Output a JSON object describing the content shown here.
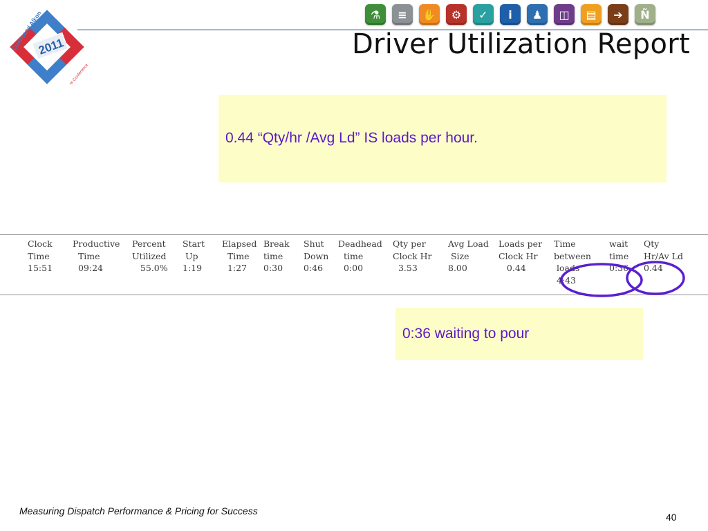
{
  "slide": {
    "title": "Driver Utilization Report",
    "note_loads": "0.44 “Qty/hr /Avg Ld” IS loads per hour.",
    "note_wait": "0:36 waiting to pour",
    "footer": "Measuring Dispatch Performance & Pricing for Success",
    "page_number": "40"
  },
  "logo": {
    "brand": "Command Alkon",
    "year": "2011",
    "tagline": "Customer Conference"
  },
  "toolbar_icons": [
    {
      "name": "flask-icon",
      "color": "#3f8f3a",
      "glyph": "⚗"
    },
    {
      "name": "layers-icon",
      "color": "#8c9196",
      "glyph": "≡"
    },
    {
      "name": "hand-icon",
      "color": "#f08a22",
      "glyph": "✋"
    },
    {
      "name": "gears-icon",
      "color": "#b8322a",
      "glyph": "⚙"
    },
    {
      "name": "checkmark-icon",
      "color": "#2aa0a0",
      "glyph": "✓"
    },
    {
      "name": "info-icon",
      "color": "#1f5ea8",
      "glyph": "i"
    },
    {
      "name": "presenter-icon",
      "color": "#2d6fb0",
      "glyph": "♟"
    },
    {
      "name": "panel-icon",
      "color": "#6e3c8a",
      "glyph": "◫"
    },
    {
      "name": "documents-icon",
      "color": "#f0a020",
      "glyph": "▤"
    },
    {
      "name": "truck-icon",
      "color": "#7a3e18",
      "glyph": "➔"
    },
    {
      "name": "n-icon",
      "color": "#9fb08a",
      "glyph": "Ñ"
    }
  ],
  "report": {
    "columns": [
      {
        "header": [
          "",
          "Clock",
          "Time"
        ],
        "value": "15:51"
      },
      {
        "header": [
          "",
          "Productive",
          "  Time"
        ],
        "value": "  09:24"
      },
      {
        "header": [
          "",
          "Percent",
          "Utilized"
        ],
        "value": "   55.0%"
      },
      {
        "header": [
          "",
          "Start",
          " Up"
        ],
        "value": "1:19"
      },
      {
        "header": [
          "",
          "Elapsed",
          "  Time"
        ],
        "value": "  1:27"
      },
      {
        "header": [
          "",
          "Break",
          "time"
        ],
        "value": "0:30"
      },
      {
        "header": [
          "",
          "Shut",
          "Down"
        ],
        "value": "0:46"
      },
      {
        "header": [
          "",
          "Deadhead",
          "  time"
        ],
        "value": "  0:00"
      },
      {
        "header": [
          "",
          "Qty per",
          "Clock Hr"
        ],
        "value": "  3.53"
      },
      {
        "header": [
          "",
          "Avg Load",
          " Size"
        ],
        "value": "8.00"
      },
      {
        "header": [
          "",
          "Loads per",
          "Clock Hr"
        ],
        "value": "   0.44"
      },
      {
        "header": [
          "Time",
          "between",
          " loads"
        ],
        "value": " 4:43"
      },
      {
        "header": [
          "",
          "wait",
          "time"
        ],
        "value": "0:36"
      },
      {
        "header": [
          "",
          "Qty",
          "Hr/Av Ld"
        ],
        "value": "0.44"
      }
    ]
  },
  "annotations": {
    "circle_color": "#5a1fd0"
  }
}
